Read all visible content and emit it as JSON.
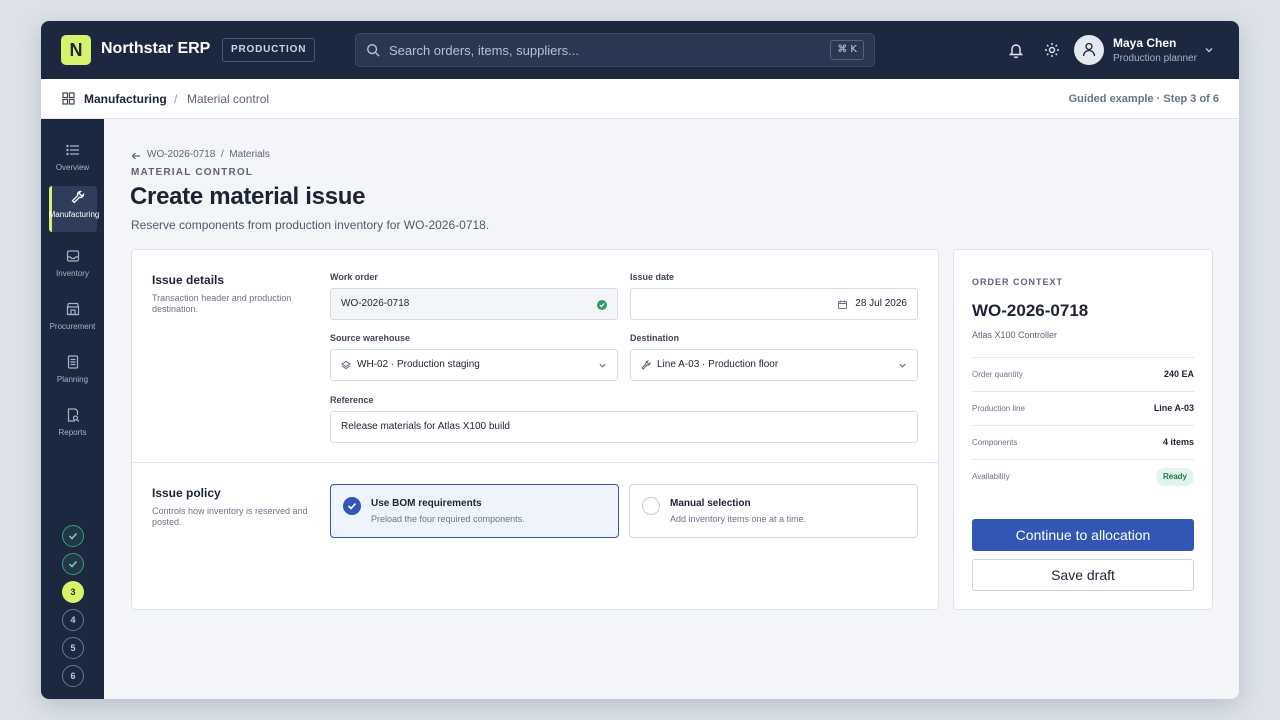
{
  "app": {
    "logo_letter": "N",
    "name": "Northstar ERP",
    "environment": "PRODUCTION"
  },
  "search": {
    "placeholder": "Search orders, items, suppliers...",
    "shortcut": "⌘ K"
  },
  "user": {
    "name": "Maya Chen",
    "role": "Production planner"
  },
  "breadcrumb": {
    "section": "Manufacturing",
    "separator": "/",
    "page": "Material control"
  },
  "guide": {
    "text": "Guided example · Step 3 of 6",
    "current_step": 3,
    "total_steps": 6
  },
  "sidebar": {
    "items": [
      {
        "label": "Overview",
        "icon": "list-icon"
      },
      {
        "label": "Manufacturing",
        "icon": "wrench-icon",
        "active": true
      },
      {
        "label": "Inventory",
        "icon": "inbox-icon"
      },
      {
        "label": "Procurement",
        "icon": "store-icon"
      },
      {
        "label": "Planning",
        "icon": "document-icon"
      },
      {
        "label": "Reports",
        "icon": "report-search-icon"
      }
    ],
    "steps": [
      {
        "label": "",
        "state": "done"
      },
      {
        "label": "",
        "state": "done"
      },
      {
        "label": "3",
        "state": "current"
      },
      {
        "label": "4",
        "state": "todo"
      },
      {
        "label": "5",
        "state": "todo"
      },
      {
        "label": "6",
        "state": "todo"
      }
    ]
  },
  "page": {
    "mini_crumb": "WO-2026-0718  /  Materials",
    "eyebrow": "MATERIAL CONTROL",
    "title": "Create material issue",
    "subtitle": "Reserve components from production inventory for WO-2026-0718."
  },
  "issue_details": {
    "title": "Issue details",
    "description": "Transaction header and production destination.",
    "work_order": {
      "label": "Work order",
      "value": "WO-2026-0718"
    },
    "issue_date": {
      "label": "Issue date",
      "value": "28 Jul 2026"
    },
    "source_warehouse": {
      "label": "Source warehouse",
      "value": "WH-02 · Production staging"
    },
    "destination": {
      "label": "Destination",
      "value": "Line A-03 · Production floor"
    },
    "reference": {
      "label": "Reference",
      "value": "Release materials for Atlas X100 build"
    }
  },
  "issue_policy": {
    "title": "Issue policy",
    "description": "Controls how inventory is reserved and posted.",
    "options": [
      {
        "title": "Use BOM requirements",
        "description": "Preload the four required components.",
        "selected": true
      },
      {
        "title": "Manual selection",
        "description": "Add inventory items one at a time.",
        "selected": false
      }
    ]
  },
  "order_context": {
    "eyebrow": "ORDER CONTEXT",
    "order": "WO-2026-0718",
    "product": "Atlas X100 Controller",
    "rows": [
      {
        "key": "Order quantity",
        "value": "240 EA"
      },
      {
        "key": "Production line",
        "value": "Line A-03"
      },
      {
        "key": "Components",
        "value": "4 items"
      },
      {
        "key": "Availability",
        "value": "Ready"
      }
    ],
    "primary_action": "Continue to allocation",
    "secondary_action": "Save draft"
  },
  "colors": {
    "topbar": "#1b2840",
    "accent_lime": "#d6f36b",
    "primary_blue": "#3356b4",
    "success_green": "#2f9a6a"
  }
}
